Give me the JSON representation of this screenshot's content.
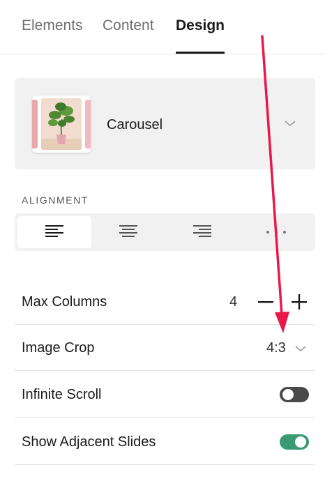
{
  "tabs": [
    {
      "label": "Elements",
      "active": false
    },
    {
      "label": "Content",
      "active": false
    },
    {
      "label": "Design",
      "active": true
    }
  ],
  "block": {
    "label": "Carousel",
    "chevron_icon": "chevron-down-icon"
  },
  "alignment": {
    "section_label": "ALIGNMENT",
    "options": [
      {
        "icon": "align-left-icon",
        "selected": true
      },
      {
        "icon": "align-center-icon",
        "selected": false
      },
      {
        "icon": "align-right-icon",
        "selected": false
      },
      {
        "icon": "more-options-icon",
        "selected": false
      }
    ]
  },
  "settings": {
    "max_columns": {
      "label": "Max Columns",
      "value": "4"
    },
    "image_crop": {
      "label": "Image Crop",
      "value": "4:3"
    },
    "infinite_scroll": {
      "label": "Infinite Scroll",
      "enabled": false
    },
    "show_adjacent_slides": {
      "label": "Show Adjacent Slides",
      "enabled": true
    }
  },
  "colors": {
    "accent_toggle_on": "#3a9a73",
    "toggle_off": "#4a4a4a",
    "annotation_arrow": "#e8194a"
  }
}
